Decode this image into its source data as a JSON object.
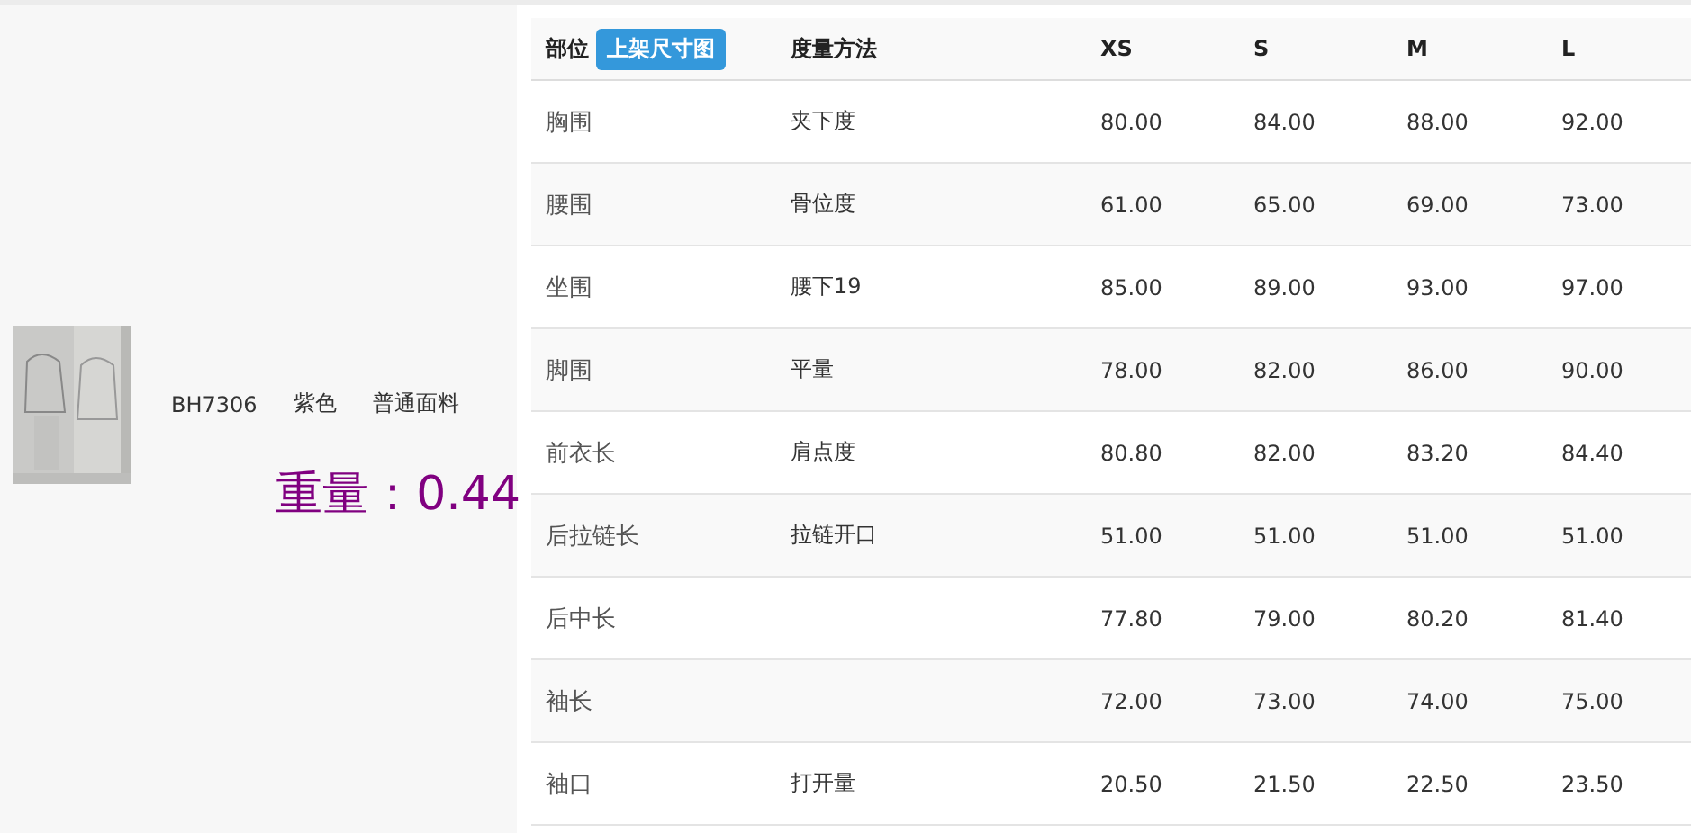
{
  "product": {
    "code": "BH7306",
    "color_name": "紫色",
    "fabric": "普通面料",
    "weight": "重量：0.44"
  },
  "table": {
    "columns": [
      "部位",
      "度量方法",
      "XS",
      "S",
      "M",
      "L"
    ],
    "header_button": "上架尺寸图",
    "rows": [
      {
        "part": "胸围",
        "method": "夹下度",
        "values": [
          "80.00",
          "84.00",
          "88.00",
          "92.00"
        ]
      },
      {
        "part": "腰围",
        "method": "骨位度",
        "values": [
          "61.00",
          "65.00",
          "69.00",
          "73.00"
        ]
      },
      {
        "part": "坐围",
        "method": "腰下19",
        "values": [
          "85.00",
          "89.00",
          "93.00",
          "97.00"
        ]
      },
      {
        "part": "脚围",
        "method": "平量",
        "values": [
          "78.00",
          "82.00",
          "86.00",
          "90.00"
        ]
      },
      {
        "part": "前衣长",
        "method": "肩点度",
        "values": [
          "80.80",
          "82.00",
          "83.20",
          "84.40"
        ]
      },
      {
        "part": "后拉链长",
        "method": "拉链开口",
        "values": [
          "51.00",
          "51.00",
          "51.00",
          "51.00"
        ]
      },
      {
        "part": "后中长",
        "values": [
          "77.80",
          "79.00",
          "80.20",
          "81.40"
        ]
      },
      {
        "part": "袖长",
        "values": [
          "72.00",
          "73.00",
          "74.00",
          "75.00"
        ]
      },
      {
        "part": "袖口",
        "method": "打开量",
        "values": [
          "20.50",
          "21.50",
          "22.50",
          "23.50"
        ]
      }
    ]
  }
}
